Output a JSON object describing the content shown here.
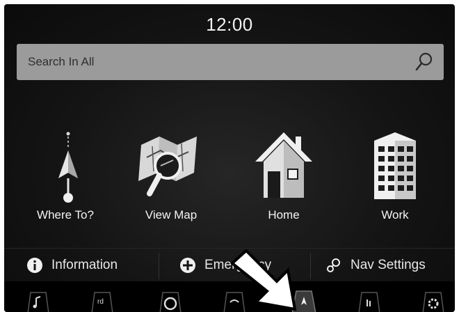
{
  "status": {
    "time": "12:00"
  },
  "search": {
    "placeholder": "Search In All",
    "icon": "search-icon"
  },
  "tiles": [
    {
      "label": "Where To?",
      "icon": "navigation-arrow-icon"
    },
    {
      "label": "View Map",
      "icon": "map-magnifier-icon"
    },
    {
      "label": "Home",
      "icon": "home-icon"
    },
    {
      "label": "Work",
      "icon": "office-building-icon"
    }
  ],
  "bottom_buttons": [
    {
      "label": "Information",
      "icon": "info-icon"
    },
    {
      "label": "Emergency",
      "icon": "plus-circle-icon"
    },
    {
      "label": "Nav Settings",
      "icon": "settings-nodes-icon"
    }
  ],
  "dock": [
    {
      "icon": "music-icon"
    },
    {
      "icon": "radio-icon"
    },
    {
      "icon": "controls-icon"
    },
    {
      "icon": "climate-icon"
    },
    {
      "icon": "nav-icon"
    },
    {
      "icon": "phone-icon"
    },
    {
      "icon": "settings-icon"
    }
  ],
  "colors": {
    "background": "#141414",
    "search_bar": "#9b9b9b",
    "text": "#f2f2f2"
  }
}
